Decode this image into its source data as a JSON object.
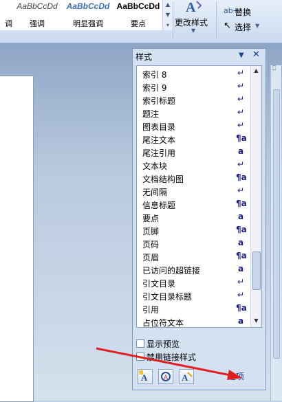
{
  "ribbon": {
    "gallery": [
      {
        "sample": "",
        "name": "调"
      },
      {
        "sample": "AaBbCcDd",
        "name": "强调"
      },
      {
        "sample": "AaBbCcDd",
        "name": "明显强调"
      },
      {
        "sample": "AaBbCcDd",
        "name": "要点"
      }
    ],
    "change_styles": "更改样式",
    "replace": "替换",
    "select": "选择"
  },
  "pane": {
    "title": "样式",
    "styles": [
      {
        "name": "索引 8",
        "type": "↵"
      },
      {
        "name": "索引 9",
        "type": "↵"
      },
      {
        "name": "索引标题",
        "type": "↵"
      },
      {
        "name": "题注",
        "type": "↵"
      },
      {
        "name": "图表目录",
        "type": "↵"
      },
      {
        "name": "尾注文本",
        "type": "¶a"
      },
      {
        "name": "尾注引用",
        "type": "a"
      },
      {
        "name": "文本块",
        "type": "↵"
      },
      {
        "name": "文档结构图",
        "type": "¶a"
      },
      {
        "name": "无间隔",
        "type": "↵"
      },
      {
        "name": "信息标题",
        "type": "¶a"
      },
      {
        "name": "要点",
        "type": "a"
      },
      {
        "name": "页脚",
        "type": "¶a"
      },
      {
        "name": "页码",
        "type": "a"
      },
      {
        "name": "页眉",
        "type": "¶a"
      },
      {
        "name": "已访问的超链接",
        "type": "a"
      },
      {
        "name": "引文目录",
        "type": "↵"
      },
      {
        "name": "引文目录标题",
        "type": "↵"
      },
      {
        "name": "引用",
        "type": "¶a"
      },
      {
        "name": "占位符文本",
        "type": "a"
      }
    ],
    "show_preview": "显示预览",
    "disable_linked": "禁用链接样式",
    "options": "选项"
  },
  "colors": {
    "accent": "#15428b",
    "arrow": "#e02020"
  },
  "icons": {
    "new_style": "new-style-icon",
    "style_inspector": "style-inspector-icon",
    "manage_styles": "manage-styles-icon",
    "close": "close-icon"
  }
}
